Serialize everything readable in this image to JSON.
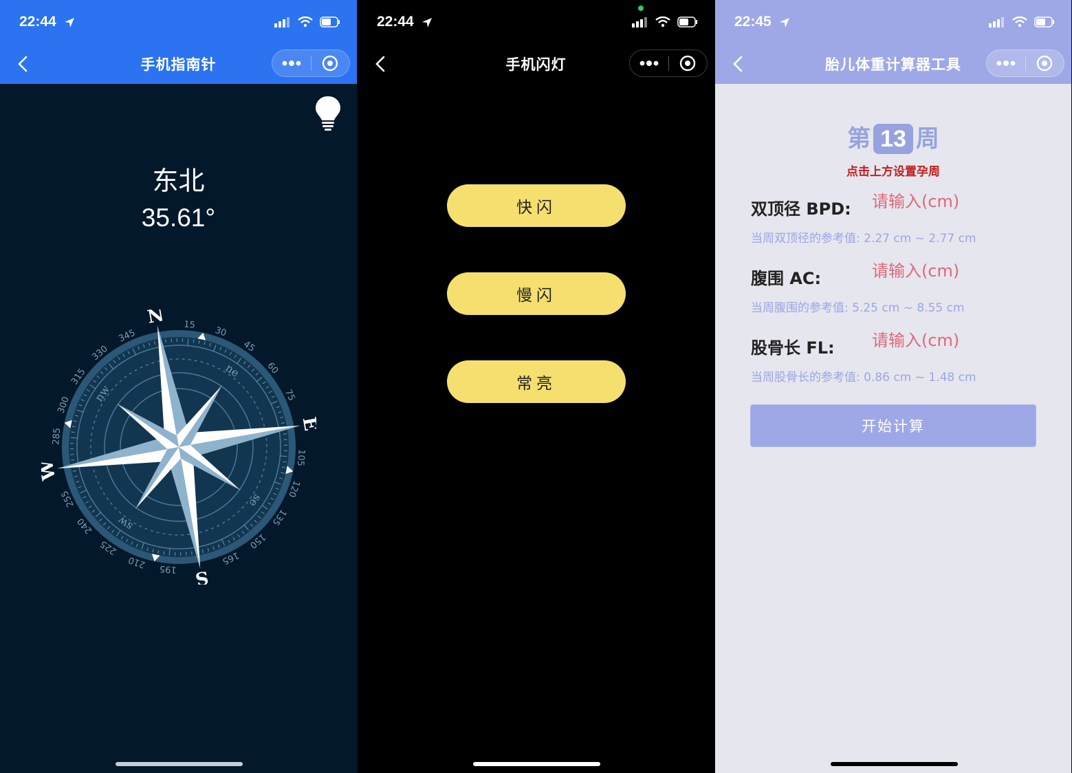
{
  "compass_screen": {
    "time": "22:44",
    "title": "手机指南针",
    "direction": "东北",
    "degrees": "35.61°",
    "dial": {
      "cardinals": [
        "N",
        "E",
        "S",
        "W"
      ],
      "intercardinals": [
        "ne",
        "se",
        "sw",
        "nw"
      ],
      "ticks": [
        "15",
        "30",
        "45",
        "60",
        "75",
        "105",
        "120",
        "135",
        "150",
        "165",
        "195",
        "210",
        "225",
        "240",
        "255",
        "285",
        "300",
        "315",
        "330",
        "345"
      ]
    }
  },
  "flashlight_screen": {
    "time": "22:44",
    "title": "手机闪灯",
    "buttons": [
      "快闪",
      "慢闪",
      "常亮"
    ]
  },
  "fetal_screen": {
    "time": "22:45",
    "title": "胎儿体重计算器工具",
    "week_prefix": "第",
    "week_number": "13",
    "week_suffix": "周",
    "hint": "点击上方设置孕周",
    "fields": [
      {
        "label": "双顶径 BPD:",
        "placeholder": "请输入(cm)",
        "reference": "当周双顶径的参考值: 2.27 cm ~ 2.77 cm"
      },
      {
        "label": "腹围 AC:",
        "placeholder": "请输入(cm)",
        "reference": "当周腹围的参考值: 5.25 cm ~ 8.55 cm"
      },
      {
        "label": "股骨长 FL:",
        "placeholder": "请输入(cm)",
        "reference": "当周股骨长的参考值: 0.86 cm ~ 1.48 cm"
      }
    ],
    "calc_button": "开始计算"
  },
  "colors": {
    "compass_nav": "#2b73f0",
    "compass_bg": "#03182a",
    "flash_button": "#f5df6e",
    "fetal_accent": "#9ea8e6",
    "fetal_hint": "#c22020",
    "fetal_placeholder": "#e06878"
  }
}
